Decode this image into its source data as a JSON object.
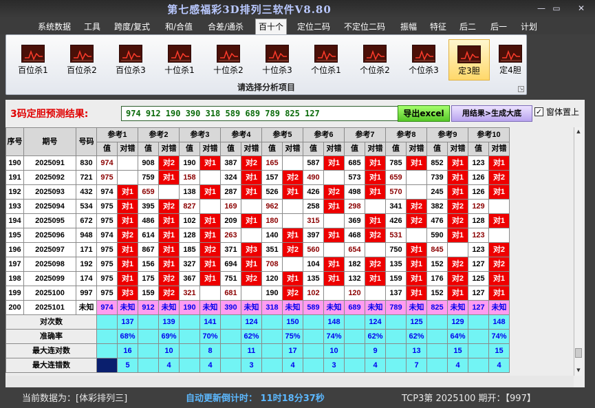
{
  "title": "第七感福彩3D排列三软件V8.80",
  "window_controls": {
    "minimize": "—",
    "restore": "▭",
    "close": "✕"
  },
  "menu": [
    "系统数据",
    "工具",
    "跨度/复式",
    "和/合值",
    "合差/通杀",
    "百十个",
    "定位二码",
    "不定位二码",
    "振幅",
    "特征",
    "后二",
    "后一",
    "计划"
  ],
  "ribbon": {
    "buttons": [
      "百位杀1",
      "百位杀2",
      "百位杀3",
      "十位杀1",
      "十位杀2",
      "十位杀3",
      "个位杀1",
      "个位杀2",
      "个位杀3",
      "定3胆",
      "定4胆"
    ],
    "selected": 9,
    "group_label": "请选择分析项目",
    "icon": "trend-chart-icon"
  },
  "prediction": {
    "label": "3码定胆预测结果:",
    "value": "974 912 190 390 318 589 689 789 825 127",
    "export_button": "导出excel",
    "generate_button": "用结果>生成大底",
    "ontop_checked": true,
    "ontop_label": "窗体置上"
  },
  "table": {
    "headers": {
      "seq": "序号",
      "period": "期号",
      "number": "号码",
      "value": "值",
      "check": "对错"
    },
    "refs": [
      "参考1",
      "参考2",
      "参考3",
      "参考4",
      "参考5",
      "参考6",
      "参考7",
      "参考8",
      "参考9",
      "参考10"
    ],
    "rows": [
      {
        "seq": "190",
        "period": "2025091",
        "num": "830",
        "refs": [
          [
            "974",
            ""
          ],
          [
            "908",
            "对2"
          ],
          [
            "190",
            "对1"
          ],
          [
            "387",
            "对2"
          ],
          [
            "165",
            ""
          ],
          [
            "587",
            "对1"
          ],
          [
            "685",
            "对1"
          ],
          [
            "785",
            "对1"
          ],
          [
            "852",
            "对1"
          ],
          [
            "123",
            "对1"
          ]
        ]
      },
      {
        "seq": "191",
        "period": "2025092",
        "num": "721",
        "refs": [
          [
            "975",
            ""
          ],
          [
            "759",
            "对1"
          ],
          [
            "158",
            ""
          ],
          [
            "324",
            "对1"
          ],
          [
            "157",
            "对2"
          ],
          [
            "490",
            ""
          ],
          [
            "573",
            "对1"
          ],
          [
            "659",
            ""
          ],
          [
            "739",
            "对1"
          ],
          [
            "126",
            "对2"
          ]
        ]
      },
      {
        "seq": "192",
        "period": "2025093",
        "num": "432",
        "refs": [
          [
            "974",
            "对1"
          ],
          [
            "659",
            ""
          ],
          [
            "138",
            "对1"
          ],
          [
            "287",
            "对1"
          ],
          [
            "526",
            "对1"
          ],
          [
            "426",
            "对2"
          ],
          [
            "498",
            "对1"
          ],
          [
            "570",
            ""
          ],
          [
            "245",
            "对1"
          ],
          [
            "126",
            "对1"
          ]
        ]
      },
      {
        "seq": "193",
        "period": "2025094",
        "num": "534",
        "refs": [
          [
            "975",
            "对1"
          ],
          [
            "395",
            "对2"
          ],
          [
            "827",
            ""
          ],
          [
            "169",
            ""
          ],
          [
            "962",
            ""
          ],
          [
            "258",
            "对1"
          ],
          [
            "298",
            ""
          ],
          [
            "341",
            "对2"
          ],
          [
            "382",
            "对2"
          ],
          [
            "129",
            ""
          ]
        ]
      },
      {
        "seq": "194",
        "period": "2025095",
        "num": "672",
        "refs": [
          [
            "975",
            "对1"
          ],
          [
            "486",
            "对1"
          ],
          [
            "102",
            "对1"
          ],
          [
            "209",
            "对1"
          ],
          [
            "180",
            ""
          ],
          [
            "315",
            ""
          ],
          [
            "369",
            "对1"
          ],
          [
            "426",
            "对2"
          ],
          [
            "476",
            "对2"
          ],
          [
            "128",
            "对1"
          ]
        ]
      },
      {
        "seq": "195",
        "period": "2025096",
        "num": "948",
        "refs": [
          [
            "974",
            "对2"
          ],
          [
            "614",
            "对1"
          ],
          [
            "128",
            "对1"
          ],
          [
            "263",
            ""
          ],
          [
            "140",
            "对1"
          ],
          [
            "397",
            "对1"
          ],
          [
            "468",
            "对2"
          ],
          [
            "531",
            ""
          ],
          [
            "590",
            "对1"
          ],
          [
            "123",
            ""
          ]
        ]
      },
      {
        "seq": "196",
        "period": "2025097",
        "num": "171",
        "refs": [
          [
            "975",
            "对1"
          ],
          [
            "867",
            "对1"
          ],
          [
            "185",
            "对2"
          ],
          [
            "371",
            "对3"
          ],
          [
            "351",
            "对2"
          ],
          [
            "560",
            ""
          ],
          [
            "654",
            ""
          ],
          [
            "750",
            "对1"
          ],
          [
            "845",
            ""
          ],
          [
            "123",
            "对2"
          ]
        ]
      },
      {
        "seq": "197",
        "period": "2025098",
        "num": "192",
        "refs": [
          [
            "975",
            "对1"
          ],
          [
            "156",
            "对1"
          ],
          [
            "327",
            "对1"
          ],
          [
            "694",
            "对1"
          ],
          [
            "708",
            ""
          ],
          [
            "104",
            "对1"
          ],
          [
            "182",
            "对2"
          ],
          [
            "135",
            "对1"
          ],
          [
            "152",
            "对2"
          ],
          [
            "127",
            "对2"
          ]
        ]
      },
      {
        "seq": "198",
        "period": "2025099",
        "num": "174",
        "refs": [
          [
            "975",
            "对1"
          ],
          [
            "175",
            "对2"
          ],
          [
            "367",
            "对1"
          ],
          [
            "751",
            "对2"
          ],
          [
            "120",
            "对1"
          ],
          [
            "135",
            "对1"
          ],
          [
            "132",
            "对1"
          ],
          [
            "159",
            "对1"
          ],
          [
            "176",
            "对2"
          ],
          [
            "125",
            "对1"
          ]
        ]
      },
      {
        "seq": "199",
        "period": "2025100",
        "num": "997",
        "refs": [
          [
            "975",
            "对3"
          ],
          [
            "159",
            "对2"
          ],
          [
            "321",
            ""
          ],
          [
            "681",
            ""
          ],
          [
            "190",
            "对2"
          ],
          [
            "102",
            ""
          ],
          [
            "120",
            ""
          ],
          [
            "137",
            "对1"
          ],
          [
            "152",
            "对1"
          ],
          [
            "127",
            "对1"
          ]
        ]
      }
    ],
    "pending": {
      "seq": "200",
      "period": "2025101",
      "num": "未知",
      "values": [
        "974",
        "912",
        "190",
        "390",
        "318",
        "589",
        "689",
        "789",
        "825",
        "127"
      ],
      "unknown": "未知"
    },
    "summary": [
      {
        "label": "对次数",
        "values": [
          "137",
          "139",
          "141",
          "124",
          "150",
          "148",
          "124",
          "125",
          "129",
          "148"
        ]
      },
      {
        "label": "准确率",
        "values": [
          "68%",
          "69%",
          "70%",
          "62%",
          "75%",
          "74%",
          "62%",
          "62%",
          "64%",
          "74%"
        ]
      },
      {
        "label": "最大连对数",
        "values": [
          "16",
          "10",
          "8",
          "11",
          "17",
          "10",
          "9",
          "13",
          "15",
          "15"
        ]
      },
      {
        "label": "最大连错数",
        "values": [
          "5",
          "4",
          "4",
          "3",
          "4",
          "3",
          "4",
          "7",
          "4",
          "4"
        ]
      }
    ]
  },
  "status": {
    "source": "当前数据为：[体彩排列三]",
    "countdown": "自动更新倒计时： 11时18分37秒",
    "period": "TCP3第 2025100 期开：【997】"
  },
  "colors": {
    "hit": "#ee0000",
    "pending": "#ff9cf0",
    "summary": "#72f4f4",
    "prediction_text": "#0a6a0a",
    "title": "#b9c8ff"
  }
}
